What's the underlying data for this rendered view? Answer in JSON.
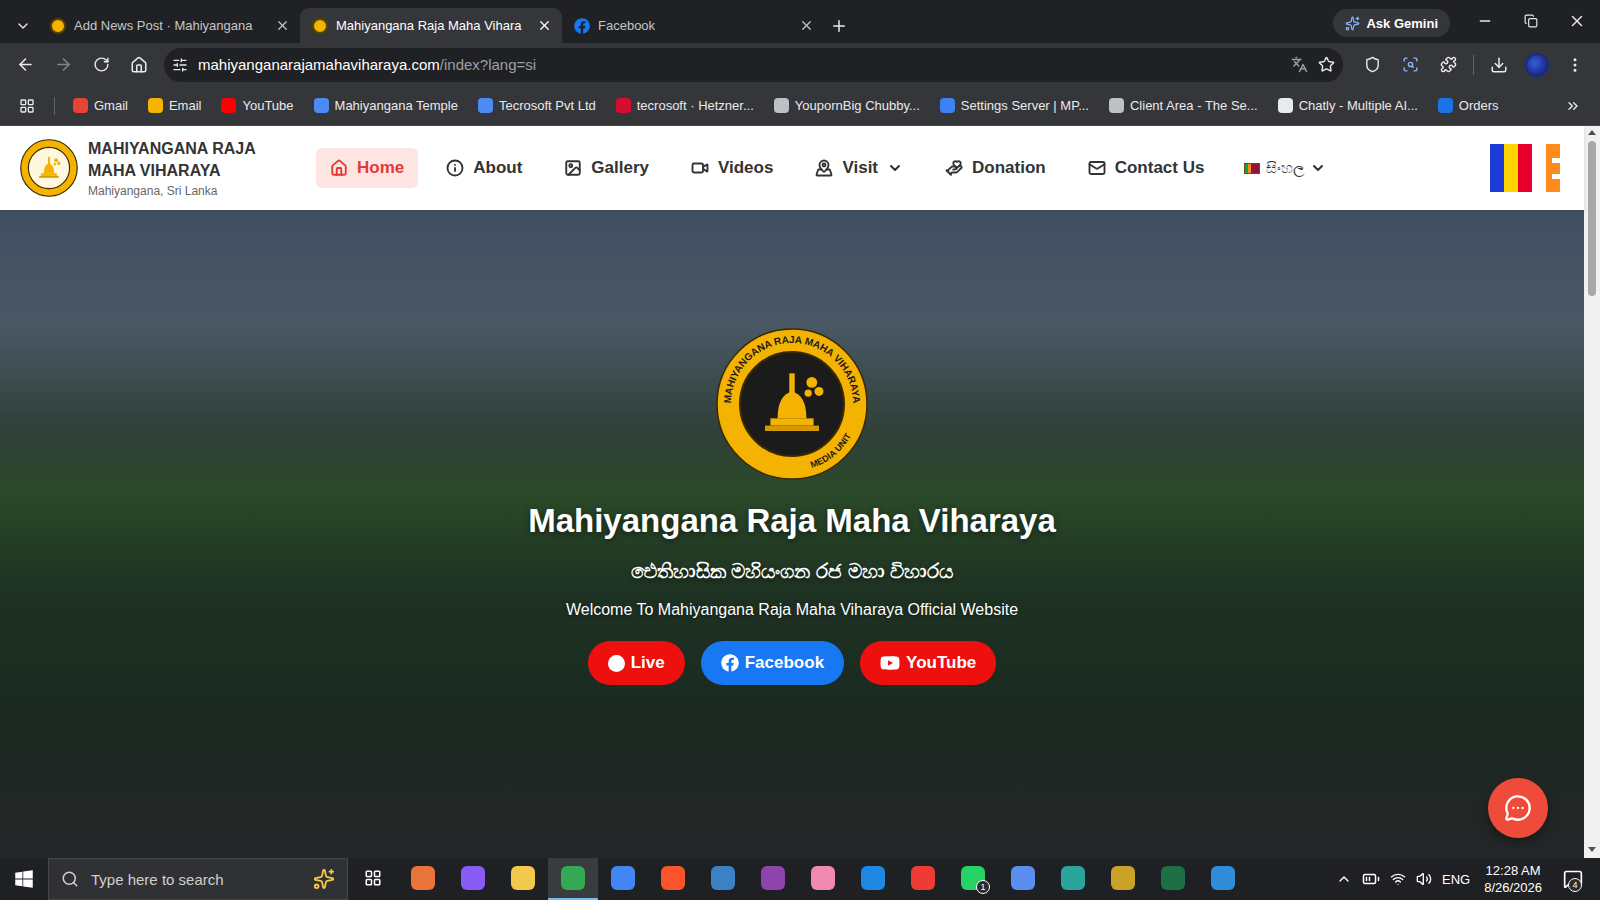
{
  "browser": {
    "tabs": [
      {
        "label": "Add News Post · Mahiyangana",
        "selected": false
      },
      {
        "label": "Mahiyangana Raja Maha Vihara",
        "selected": true
      },
      {
        "label": "Facebook",
        "selected": false
      }
    ],
    "ask_gemini": "Ask Gemini",
    "address": {
      "host": "mahiyanganarajamahaviharaya.com",
      "path": "/index?lang=si"
    },
    "bookmarks": [
      {
        "label": "Gmail",
        "color": "#ea4335"
      },
      {
        "label": "Email",
        "color": "#f4b400"
      },
      {
        "label": "YouTube",
        "color": "#ff0000"
      },
      {
        "label": "Mahiyangana Temple",
        "color": "#4c8bf5"
      },
      {
        "label": "Tecrosoft Pvt Ltd",
        "color": "#4c8bf5"
      },
      {
        "label": "tecrosoft · Hetzner...",
        "color": "#d50c2d"
      },
      {
        "label": "YoupornBig Chubby...",
        "color": "#bdc1c6"
      },
      {
        "label": "Settings Server | MP...",
        "color": "#3b82f6"
      },
      {
        "label": "Client Area - The Se...",
        "color": "#bdc1c6"
      },
      {
        "label": "Chatly - Multiple AI...",
        "color": "#e8eaed"
      },
      {
        "label": "Orders",
        "color": "#1a73e8"
      }
    ]
  },
  "site": {
    "brand": {
      "name_lines": [
        "MAHIYANGANA RAJA",
        "MAHA VIHARAYA"
      ],
      "location": "Mahiyangana, Sri Lanka"
    },
    "nav": [
      {
        "label": "Home",
        "selected": true,
        "dropdown": false
      },
      {
        "label": "About",
        "selected": false,
        "dropdown": false
      },
      {
        "label": "Gallery",
        "selected": false,
        "dropdown": false
      },
      {
        "label": "Videos",
        "selected": false,
        "dropdown": false
      },
      {
        "label": "Visit",
        "selected": false,
        "dropdown": true
      },
      {
        "label": "Donation",
        "selected": false,
        "dropdown": false
      },
      {
        "label": "Contact Us",
        "selected": false,
        "dropdown": false
      }
    ],
    "language": {
      "label": "සිංහල",
      "dropdown": true
    },
    "hero": {
      "logo_ring": "MAHIYANGANA RAJA MAHA VIHARAYA",
      "logo_unit": "MEDIA UNIT",
      "title": "Mahiyangana Raja Maha Viharaya",
      "subtitle": "ඓතිහාසික මහියංගන රජ මහා විහාරය",
      "welcome": "Welcome To Mahiyangana Raja Maha Viharaya Official Website",
      "buttons": [
        {
          "label": "Live",
          "kind": "live",
          "color": "#ee0f0f"
        },
        {
          "label": "Facebook",
          "kind": "facebook",
          "color": "#1877f2"
        },
        {
          "label": "YouTube",
          "kind": "youtube",
          "color": "#ee0f0f"
        }
      ]
    }
  },
  "taskbar": {
    "search_placeholder": "Type here to search",
    "apps": [
      {
        "color": "#e8743b",
        "selected": false,
        "badge": ""
      },
      {
        "color": "#8a5cf6",
        "selected": false,
        "badge": ""
      },
      {
        "color": "#f2c94c",
        "selected": false,
        "badge": ""
      },
      {
        "color": "#34a853",
        "selected": true,
        "badge": ""
      },
      {
        "color": "#4285f4",
        "selected": false,
        "badge": ""
      },
      {
        "color": "#fb542b",
        "selected": false,
        "badge": ""
      },
      {
        "color": "#3b82c4",
        "selected": false,
        "badge": ""
      },
      {
        "color": "#8e44ad",
        "selected": false,
        "badge": ""
      },
      {
        "color": "#f08ab0",
        "selected": false,
        "badge": ""
      },
      {
        "color": "#1e88e5",
        "selected": false,
        "badge": ""
      },
      {
        "color": "#ef3b36",
        "selected": false,
        "badge": ""
      },
      {
        "color": "#25d366",
        "selected": false,
        "badge": "1"
      },
      {
        "color": "#5b8def",
        "selected": false,
        "badge": ""
      },
      {
        "color": "#2aa59b",
        "selected": false,
        "badge": ""
      },
      {
        "color": "#c9a227",
        "selected": false,
        "badge": ""
      },
      {
        "color": "#1d7044",
        "selected": false,
        "badge": ""
      },
      {
        "color": "#2f8cd8",
        "selected": false,
        "badge": ""
      }
    ],
    "language": "ENG",
    "time": "12:28 AM",
    "date": "8/26/2026",
    "notifications": "4"
  }
}
